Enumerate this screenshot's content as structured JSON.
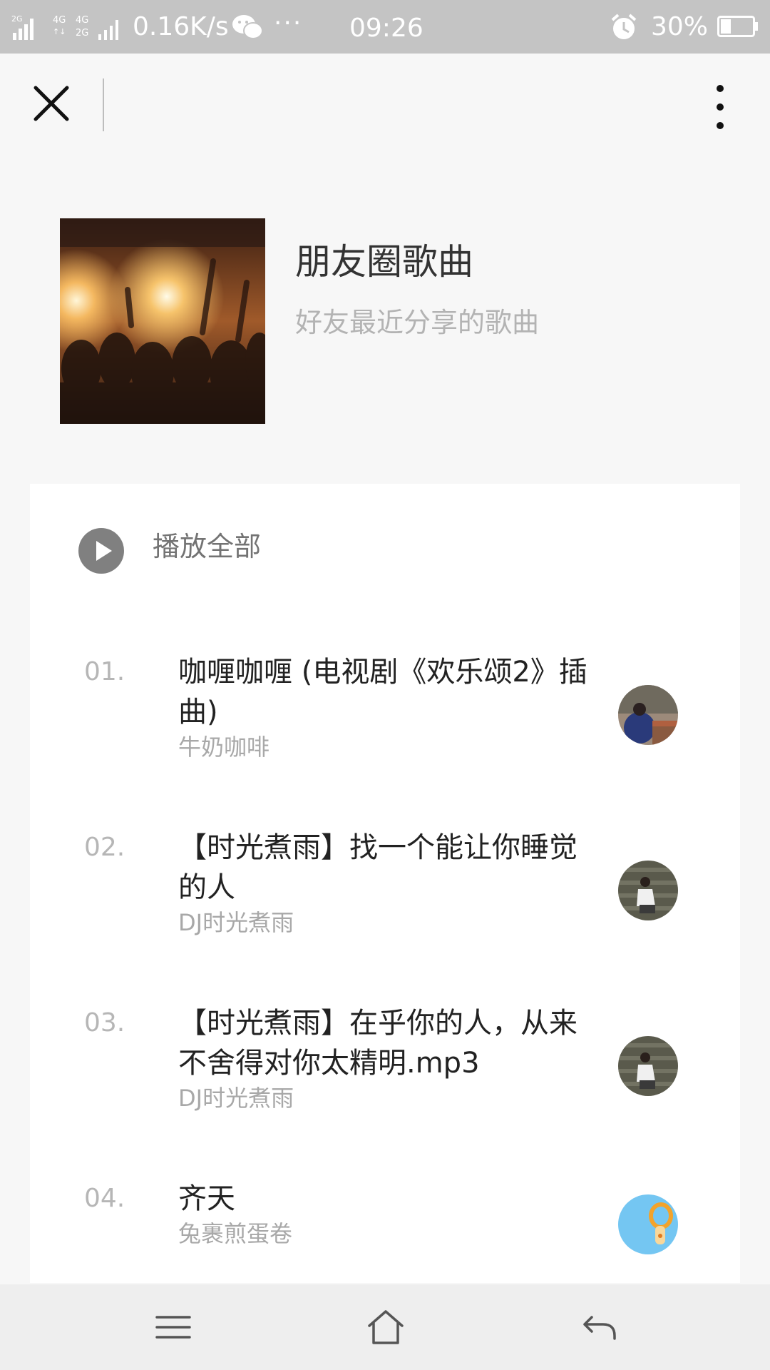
{
  "status_bar": {
    "net_speed": "0.16K/s",
    "more_dots": "···",
    "time": "09:26",
    "battery": "30%",
    "signal_labels": [
      "2G",
      "4G",
      "4G",
      "2G"
    ]
  },
  "top_bar": {
    "close_icon": "close-icon",
    "more_icon": "more-vertical-icon"
  },
  "playlist": {
    "title": "朋友圈歌曲",
    "subtitle": "好友最近分享的歌曲",
    "play_all_label": "播放全部"
  },
  "songs": [
    {
      "no": "01.",
      "title": "咖喱咖喱 (电视剧《欢乐颂2》插曲)",
      "artist": "牛奶咖啡"
    },
    {
      "no": "02.",
      "title": "【时光煮雨】找一个能让你睡觉的人",
      "artist": "DJ时光煮雨"
    },
    {
      "no": "03.",
      "title": "【时光煮雨】在乎你的人，从来不舍得对你太精明.mp3",
      "artist": "DJ时光煮雨"
    },
    {
      "no": "04.",
      "title": "齐天",
      "artist": "兔裹煎蛋卷"
    }
  ],
  "colors": {
    "status_bar_bg": "#c4c4c4",
    "page_bg": "#f7f7f7",
    "nav_bg": "#eeeeee",
    "play_icon": "#808080"
  },
  "nav": {
    "menu_icon": "menu-icon",
    "home_icon": "home-icon",
    "back_icon": "back-icon"
  }
}
